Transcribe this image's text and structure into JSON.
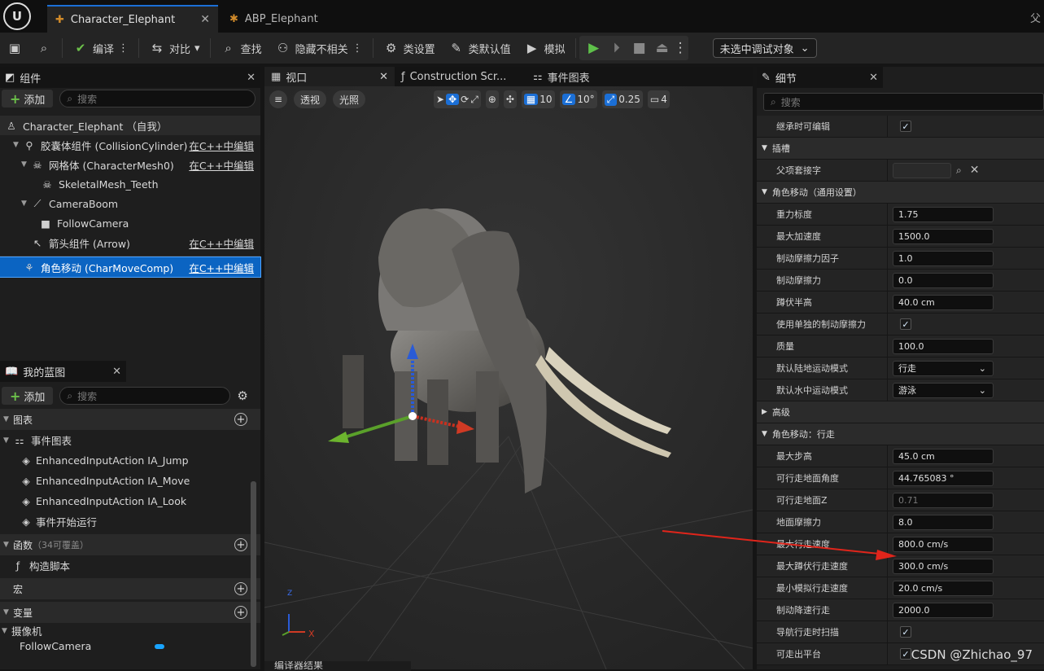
{
  "window": {
    "corner_char": "父"
  },
  "tabs": [
    {
      "label": "Character_Elephant",
      "close": "✕"
    },
    {
      "label": "ABP_Elephant"
    }
  ],
  "toolbar": {
    "compile": "编译",
    "diff": "对比",
    "find": "查找",
    "hide_unrelated": "隐藏不相关",
    "class_settings": "类设置",
    "class_defaults": "类默认值",
    "simulate": "模拟",
    "debug_object": "未选中调试对象"
  },
  "components": {
    "title": "组件",
    "add": "添加",
    "search_placeholder": "搜索",
    "self": "Character_Elephant （自我）",
    "items": [
      {
        "label": "胶囊体组件 (CollisionCylinder)",
        "edit": "在C++中编辑"
      },
      {
        "label": "网格体 (CharacterMesh0)",
        "edit": "在C++中编辑"
      },
      {
        "label": "SkeletalMesh_Teeth"
      },
      {
        "label": "CameraBoom"
      },
      {
        "label": "FollowCamera"
      },
      {
        "label": "箭头组件 (Arrow)",
        "edit": "在C++中编辑"
      },
      {
        "label": "角色移动 (CharMoveComp)",
        "edit": "在C++中编辑"
      }
    ]
  },
  "my_blueprint": {
    "title": "我的蓝图",
    "add": "添加",
    "search_placeholder": "搜索",
    "graphs": "图表",
    "event_graph": "事件图表",
    "events": [
      "EnhancedInputAction IA_Jump",
      "EnhancedInputAction IA_Move",
      "EnhancedInputAction IA_Look",
      "事件开始运行"
    ],
    "functions": "函数",
    "functions_note": "（34可覆盖）",
    "construction": "构造脚本",
    "macros": "宏",
    "variables": "变量",
    "var_category": "摄像机",
    "var_item": "FollowCamera"
  },
  "viewport": {
    "tab_viewport": "视口",
    "tab_construction": "Construction Scr...",
    "tab_event_graph": "事件图表",
    "perspective": "透视",
    "lighting": "光照",
    "grid_snap": "10",
    "rot_snap": "10°",
    "scale_snap": "0.25",
    "cam_speed": "4",
    "bottom_tab": "编译器结果",
    "axis_x": "X",
    "axis_z": "Z"
  },
  "details": {
    "title": "细节",
    "search_placeholder": "搜索",
    "rows_top": [
      {
        "label": "继承时可编辑",
        "check": "✓"
      }
    ],
    "socket_cat": "插槽",
    "parent_socket": "父项套接字",
    "move_cat": "角色移动（通用设置）",
    "move_rows": [
      {
        "label": "重力标度",
        "value": "1.75"
      },
      {
        "label": "最大加速度",
        "value": "1500.0"
      },
      {
        "label": "制动摩擦力因子",
        "value": "1.0"
      },
      {
        "label": "制动摩擦力",
        "value": "0.0"
      },
      {
        "label": "蹲伏半高",
        "value": "40.0 cm"
      },
      {
        "label": "使用单独的制动摩擦力",
        "check": "✓"
      },
      {
        "label": "质量",
        "value": "100.0"
      },
      {
        "label": "默认陆地运动模式",
        "select": "行走"
      },
      {
        "label": "默认水中运动模式",
        "select": "游泳"
      }
    ],
    "advanced": "高级",
    "walk_cat": "角色移动：行走",
    "walk_rows": [
      {
        "label": "最大步高",
        "value": "45.0 cm"
      },
      {
        "label": "可行走地面角度",
        "value": "44.765083 °"
      },
      {
        "label": "可行走地面Z",
        "value": "0.71",
        "disabled": true
      },
      {
        "label": "地面摩擦力",
        "value": "8.0"
      },
      {
        "label": "最大行走速度",
        "value": "800.0 cm/s"
      },
      {
        "label": "最大蹲伏行走速度",
        "value": "300.0 cm/s"
      },
      {
        "label": "最小模拟行走速度",
        "value": "20.0 cm/s"
      },
      {
        "label": "制动降速行走",
        "value": "2000.0"
      },
      {
        "label": "导航行走时扫描",
        "check": "✓"
      },
      {
        "label": "可走出平台",
        "check": "✓"
      }
    ]
  },
  "watermark": "CSDN @Zhichao_97",
  "colors": {
    "accent": "#1b6fd6",
    "play_green": "#5ec04a",
    "arrow_red": "#e0251b"
  }
}
